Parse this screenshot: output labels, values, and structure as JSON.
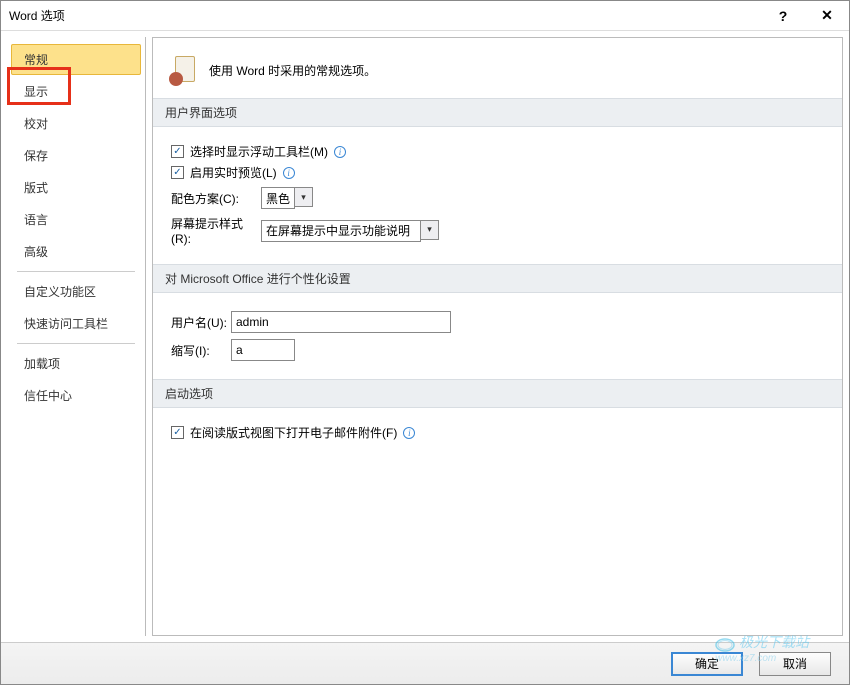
{
  "dialog": {
    "title": "Word 选项",
    "help_label": "?",
    "close_label": "✕"
  },
  "sidebar": {
    "items": [
      {
        "label": "常规",
        "selected": true
      },
      {
        "label": "显示"
      },
      {
        "label": "校对"
      },
      {
        "label": "保存"
      },
      {
        "label": "版式"
      },
      {
        "label": "语言"
      },
      {
        "label": "高级"
      }
    ],
    "items2": [
      {
        "label": "自定义功能区"
      },
      {
        "label": "快速访问工具栏"
      }
    ],
    "items3": [
      {
        "label": "加载项"
      },
      {
        "label": "信任中心"
      }
    ]
  },
  "banner": {
    "text": "使用 Word 时采用的常规选项。"
  },
  "ui_section": {
    "header": "用户界面选项",
    "minibar": {
      "checked": true,
      "label": "选择时显示浮动工具栏(M)"
    },
    "livepreview": {
      "checked": true,
      "label": "启用实时预览(L)"
    },
    "colorscheme": {
      "label": "配色方案(C):",
      "value": "黑色"
    },
    "screentip": {
      "label": "屏幕提示样式(R):",
      "value": "在屏幕提示中显示功能说明"
    }
  },
  "personalize_section": {
    "header": "对 Microsoft Office 进行个性化设置",
    "username": {
      "label": "用户名(U):",
      "value": "admin"
    },
    "initials": {
      "label": "缩写(I):",
      "value": "a"
    }
  },
  "startup_section": {
    "header": "启动选项",
    "readingview": {
      "checked": true,
      "label": "在阅读版式视图下打开电子邮件附件(F)"
    }
  },
  "footer": {
    "ok": "确定",
    "cancel": "取消"
  },
  "watermark": {
    "line1": "极光下载站",
    "line2": "www.xz7.com"
  }
}
